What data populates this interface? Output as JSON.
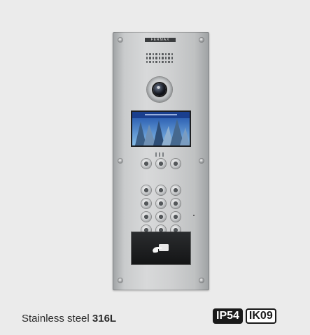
{
  "product": {
    "brand_label": "FERMAX",
    "material_text": "Stainless steel ",
    "material_grade": "316L",
    "ip_rating": "IP54",
    "ik_rating": "IK09"
  },
  "icons": {
    "camera": "camera-icon",
    "proximity": "card-reader-icon"
  },
  "colors": {
    "background": "#ebebeb",
    "steel": "#cfd0d1",
    "badge_dark": "#1a1a1a"
  }
}
